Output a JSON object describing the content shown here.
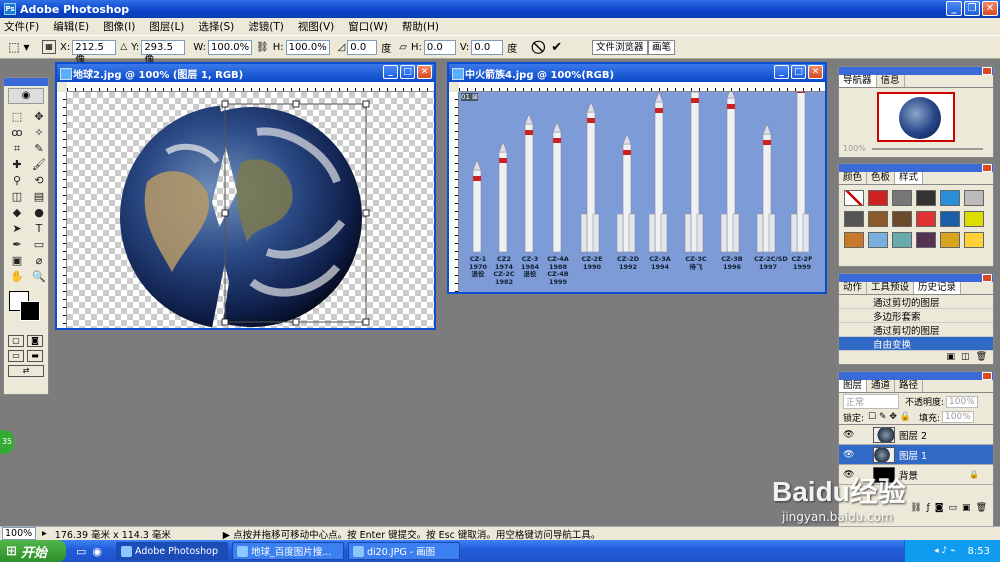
{
  "app": {
    "title": "Adobe Photoshop"
  },
  "menu": [
    "文件(F)",
    "编辑(E)",
    "图像(I)",
    "图层(L)",
    "选择(S)",
    "滤镜(T)",
    "视图(V)",
    "窗口(W)",
    "帮助(H)"
  ],
  "options": {
    "x_label": "X:",
    "x_value": "212.5 像",
    "y_label": "Y:",
    "y_value": "293.5 像",
    "w_label": "W:",
    "w_value": "100.0%",
    "h_label": "H:",
    "h_value": "100.0%",
    "angle_value": "0.0",
    "angle_unit": "度",
    "hskew_label": "H:",
    "hskew_value": "0.0",
    "vskew_label": "V:",
    "vskew_value": "0.0",
    "skew_unit": "度"
  },
  "tabs": {
    "file_browser": "文件浏览器",
    "brushes": "画笔"
  },
  "doc1": {
    "title": "地球2.jpg @ 100% (图层 1, RGB)"
  },
  "doc2": {
    "title": "中火箭族4.jpg @ 100%(RGB)",
    "tag": "01 ⊠",
    "rockets": [
      {
        "name": "CZ-1",
        "years": "1970",
        "note": "退役"
      },
      {
        "name": "CZ2",
        "years": "1974\nCZ-2C",
        "note": "1982"
      },
      {
        "name": "CZ-3",
        "years": "1984",
        "note": "退役"
      },
      {
        "name": "CZ-4A",
        "years": "1988\nCZ-4B",
        "note": "1999"
      },
      {
        "name": "CZ-2E",
        "years": "1990",
        "note": ""
      },
      {
        "name": "CZ-2D",
        "years": "1992",
        "note": ""
      },
      {
        "name": "CZ-3A",
        "years": "1994",
        "note": ""
      },
      {
        "name": "CZ-3C",
        "years": "待飞",
        "note": ""
      },
      {
        "name": "CZ-3B",
        "years": "1996",
        "note": ""
      },
      {
        "name": "CZ-2C/SD",
        "years": "1997",
        "note": ""
      },
      {
        "name": "CZ-2F",
        "years": "1999",
        "note": ""
      }
    ]
  },
  "navigator": {
    "tabs": [
      "导航器",
      "信息"
    ],
    "zoom": "100%"
  },
  "swatches": {
    "tabs": [
      "颜色",
      "色板",
      "样式"
    ]
  },
  "history": {
    "tabs": [
      "动作",
      "工具预设",
      "历史记录"
    ],
    "items": [
      "通过剪切的图层",
      "多边形套索",
      "通过剪切的图层",
      "自由变换"
    ]
  },
  "layers": {
    "tabs": [
      "图层",
      "通道",
      "路径"
    ],
    "mode": "正常",
    "opacity_label": "不透明度:",
    "opacity": "100%",
    "lock_label": "锁定:",
    "fill_label": "填充:",
    "fill": "100%",
    "items": [
      {
        "name": "图层 2"
      },
      {
        "name": "图层 1"
      },
      {
        "name": "背景"
      }
    ]
  },
  "status": {
    "zoom": "100%",
    "doc_size": "176.39 毫米 x 114.3 毫米",
    "hint": "▶ 点按并拖移可移动中心点。按 Enter 键提交。按 Esc 键取消。用空格键访问导航工具。"
  },
  "taskbar": {
    "start": "开始",
    "tasks": [
      "Adobe Photoshop",
      "地球_百度图片搜...",
      "di20.JPG - 画图"
    ],
    "clock": "8:53"
  },
  "watermark": {
    "text": "Baidu经验",
    "sub": "jingyan.baidu.com"
  },
  "side_badge": "35"
}
